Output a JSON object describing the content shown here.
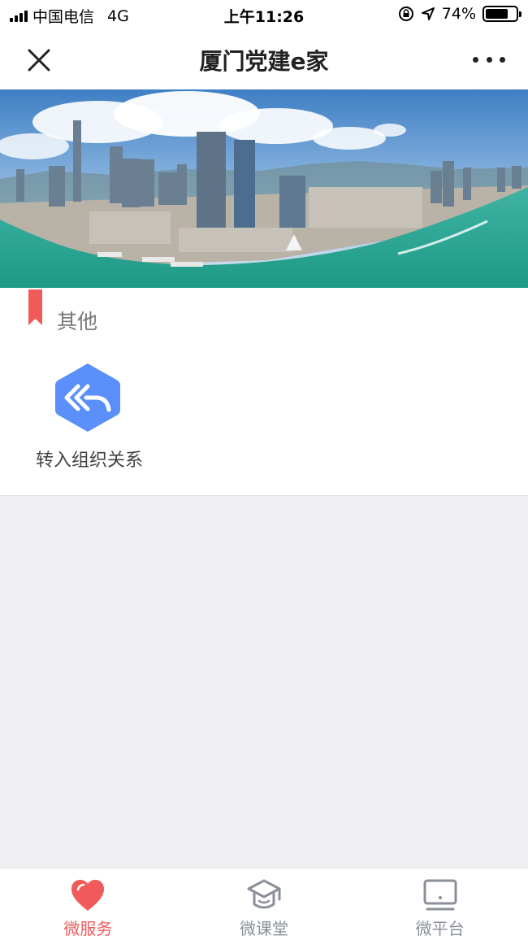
{
  "status_bar": {
    "carrier": "中国电信",
    "network": "4G",
    "time": "上午11:26",
    "battery": "74%",
    "battery_level": 0.74
  },
  "nav": {
    "title": "厦门党建e家",
    "close_icon": "close-icon",
    "more_icon": "more-icon"
  },
  "section": {
    "title": "其他",
    "accent_color": "#f25a5a"
  },
  "tiles": [
    {
      "label": "转入组织关系",
      "icon": "reply-all-icon",
      "color": "#5b8ff9"
    }
  ],
  "tab_bar": {
    "active_color": "#f05a5a",
    "inactive_color": "#8a8f99",
    "tabs": [
      {
        "label": "微服务",
        "icon": "heart-icon",
        "active": true
      },
      {
        "label": "微课堂",
        "icon": "graduation-cap-icon",
        "active": false
      },
      {
        "label": "微平台",
        "icon": "monitor-icon",
        "active": false
      }
    ]
  }
}
